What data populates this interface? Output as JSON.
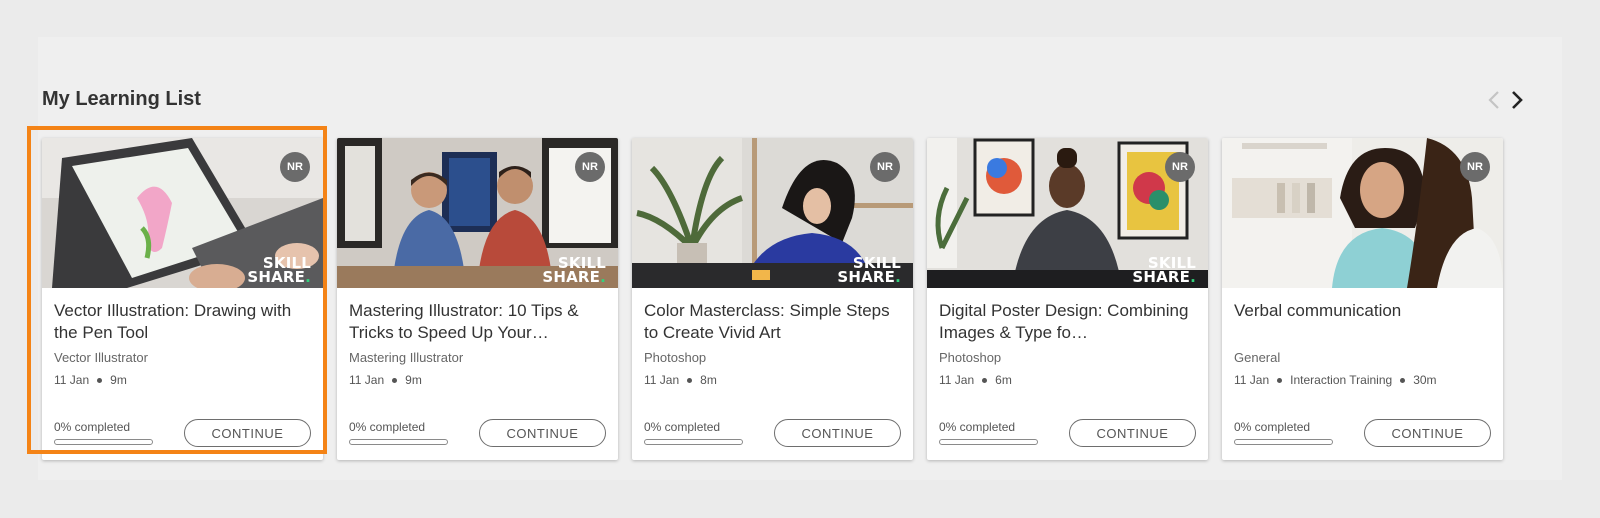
{
  "section": {
    "title": "My Learning List"
  },
  "nav": {
    "prev_icon": "chevron-left-icon",
    "next_icon": "chevron-right-icon",
    "prev_enabled": false,
    "next_enabled": true
  },
  "colors": {
    "focus_ring": "#f48316",
    "badge_bg": "#6b6b6b",
    "brand_dot": "#32d27d"
  },
  "cards": [
    {
      "badge": "NR",
      "title": "Vector Illustration: Drawing with the Pen Tool",
      "category": "Vector Illustrator",
      "date": "11 Jan",
      "extra": "",
      "duration": "9m",
      "progress_label": "0% completed",
      "progress": 0,
      "button": "CONTINUE",
      "brand": [
        "SKILL",
        "SHARE"
      ],
      "focused": true
    },
    {
      "badge": "NR",
      "title": "Mastering Illustrator: 10 Tips & Tricks to Speed Up Your…",
      "category": "Mastering Illustrator",
      "date": "11 Jan",
      "extra": "",
      "duration": "9m",
      "progress_label": "0% completed",
      "progress": 0,
      "button": "CONTINUE",
      "brand": [
        "SKILL",
        "SHARE"
      ],
      "focused": false
    },
    {
      "badge": "NR",
      "title": "Color Masterclass: Simple Steps to Create Vivid Art",
      "category": "Photoshop",
      "date": "11 Jan",
      "extra": "",
      "duration": "8m",
      "progress_label": "0% completed",
      "progress": 0,
      "button": "CONTINUE",
      "brand": [
        "SKILL",
        "SHARE"
      ],
      "focused": false
    },
    {
      "badge": "NR",
      "title": "Digital Poster Design: Combining Images & Type fo…",
      "category": "Photoshop",
      "date": "11 Jan",
      "extra": "",
      "duration": "6m",
      "progress_label": "0% completed",
      "progress": 0,
      "button": "CONTINUE",
      "brand": [
        "SKILL",
        "SHARE"
      ],
      "focused": false
    },
    {
      "badge": "NR",
      "title": "Verbal communication",
      "category": "General",
      "date": "11 Jan",
      "extra": "Interaction Training",
      "duration": "30m",
      "progress_label": "0% completed",
      "progress": 0,
      "button": "CONTINUE",
      "brand": null,
      "focused": false
    }
  ]
}
